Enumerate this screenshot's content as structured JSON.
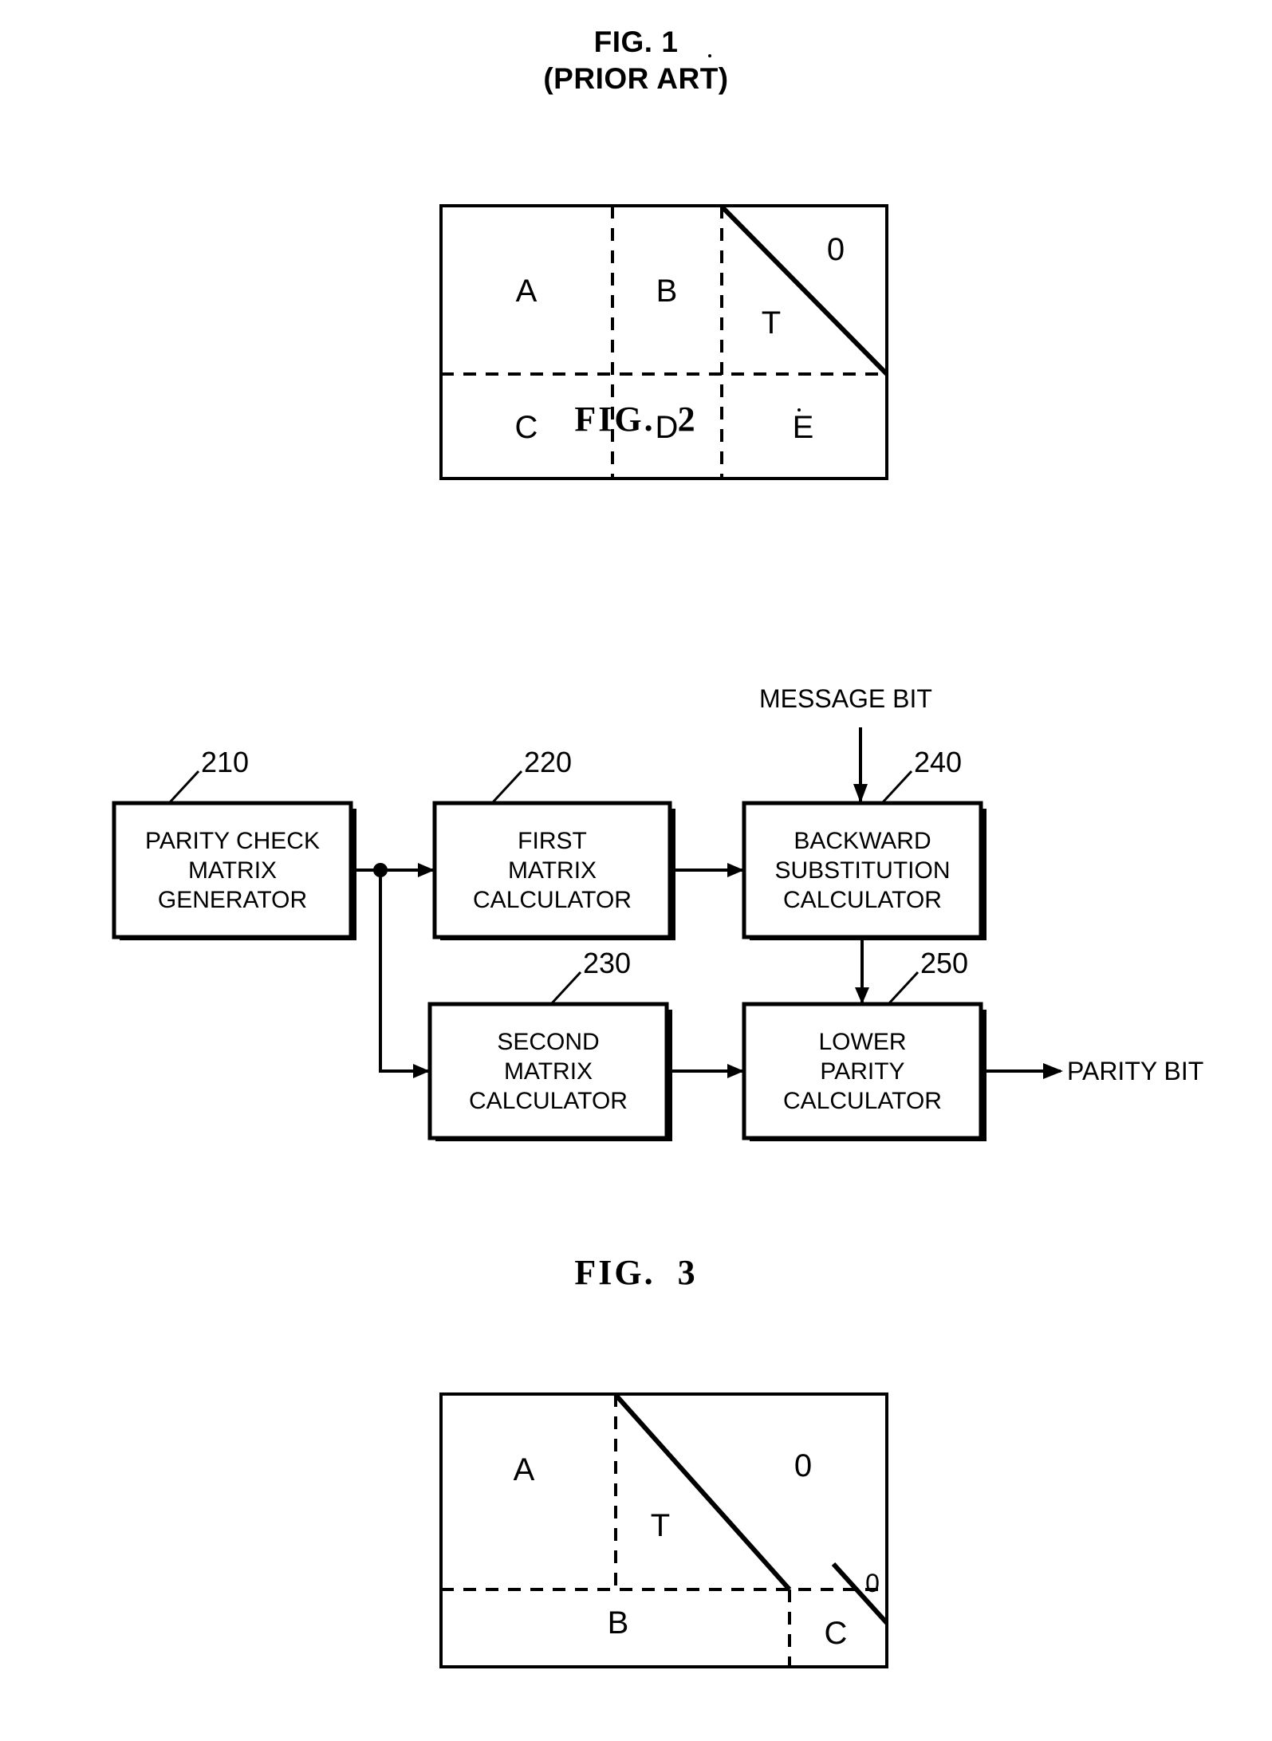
{
  "figures": [
    {
      "id": "fig1",
      "title_line1": "FIG. 1",
      "title_line2": "(PRIOR ART)",
      "cells": {
        "a": "A",
        "b": "B",
        "t": "T",
        "zero": "0",
        "c": "C",
        "d": "D",
        "e": "E"
      }
    },
    {
      "id": "fig2",
      "title": "FIG.  2"
    },
    {
      "id": "fig3",
      "title": "FIG.  3",
      "cells": {
        "a": "A",
        "t": "T",
        "zero_upper": "0",
        "b": "B",
        "c": "C",
        "zero_lower": "0"
      }
    }
  ],
  "fig2": {
    "inputs": {
      "message_bit": "MESSAGE BIT"
    },
    "outputs": {
      "parity_bit": "PARITY BIT"
    },
    "blocks": [
      {
        "ref": "210",
        "lines": [
          "PARITY CHECK",
          "MATRIX",
          "GENERATOR"
        ]
      },
      {
        "ref": "220",
        "lines": [
          "FIRST",
          "MATRIX",
          "CALCULATOR"
        ]
      },
      {
        "ref": "240",
        "lines": [
          "BACKWARD",
          "SUBSTITUTION",
          "CALCULATOR"
        ]
      },
      {
        "ref": "230",
        "lines": [
          "SECOND",
          "MATRIX",
          "CALCULATOR"
        ]
      },
      {
        "ref": "250",
        "lines": [
          "LOWER",
          "PARITY",
          "CALCULATOR"
        ]
      }
    ]
  },
  "colors": {
    "ink": "#000000",
    "paper": "#ffffff"
  }
}
